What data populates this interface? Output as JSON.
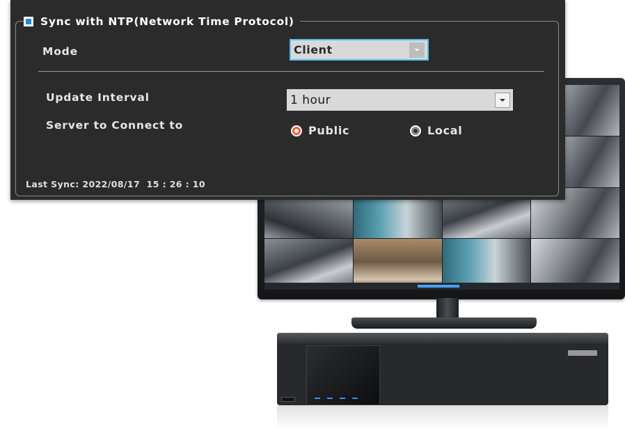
{
  "ntp": {
    "sync_enabled": true,
    "sync_label": "Sync with NTP(Network Time Protocol)",
    "mode_label": "Mode",
    "mode_value": "Client",
    "update_interval_label": "Update Interval",
    "update_interval_value": "1 hour",
    "server_label": "Server to Connect to",
    "server_options": [
      {
        "label": "Public",
        "selected": true
      },
      {
        "label": "Local",
        "selected": false
      }
    ],
    "last_sync": "Last Sync: 2022/08/17  15 : 26 : 10"
  },
  "colors": {
    "panel_bg": "#2b2b2b",
    "accent_blue": "#1e88e5",
    "focus_border": "#4fc3f7",
    "radio_selected": "#ff5a36"
  },
  "icons": {
    "checkbox": "checkbox-checked-icon",
    "dropdown": "chevron-down-icon",
    "radio_on": "radio-selected-icon",
    "radio_off": "radio-unselected-icon"
  }
}
